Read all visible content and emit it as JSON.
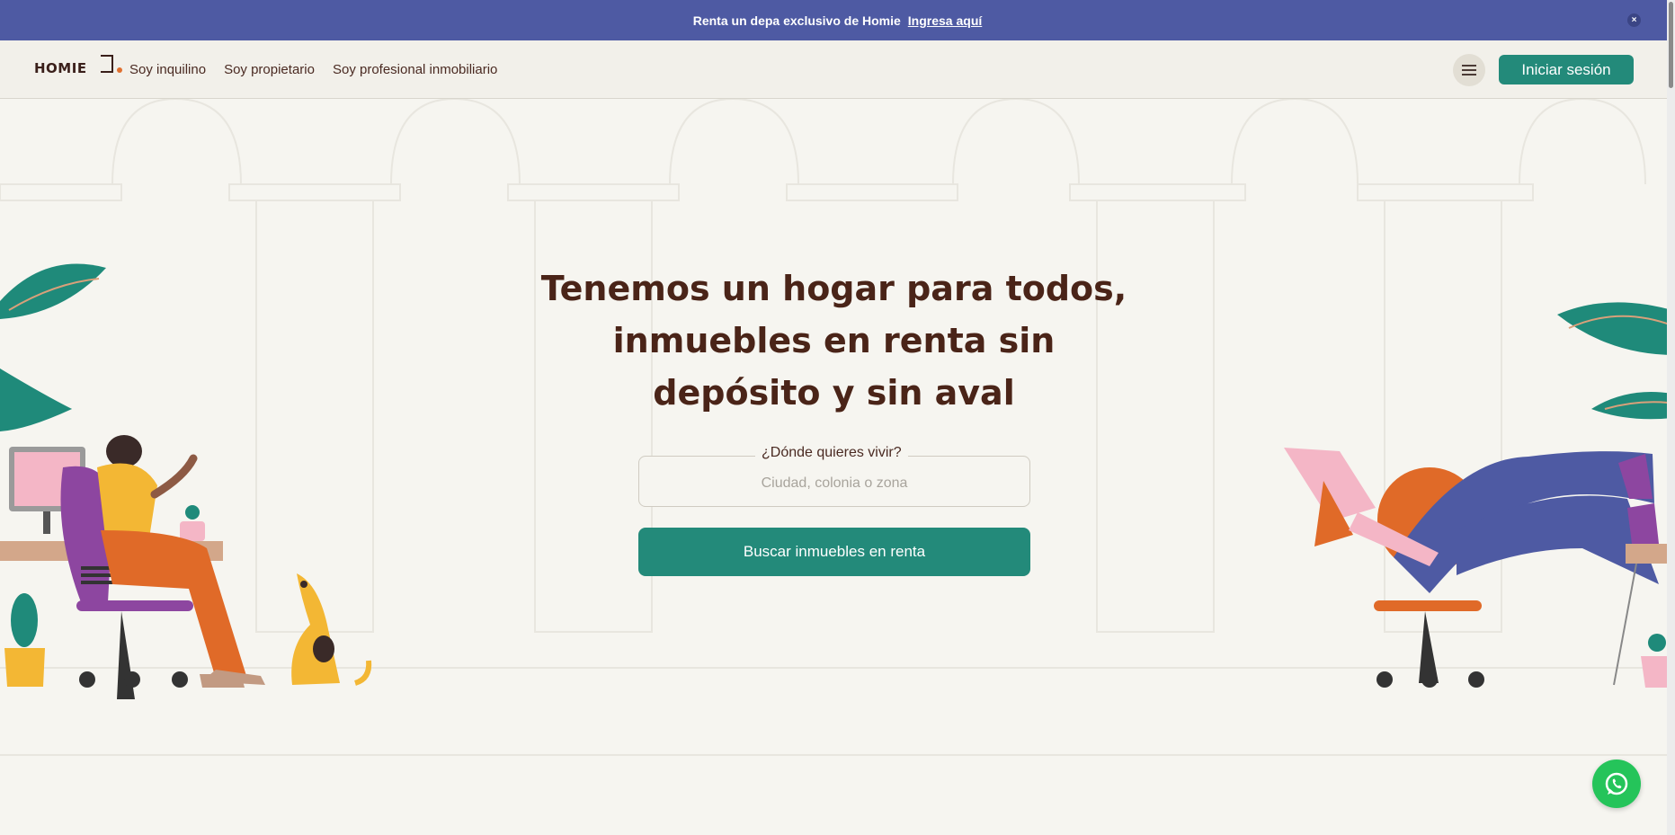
{
  "announcement": {
    "text": "Renta un depa exclusivo de Homie",
    "link": "Ingresa aquí",
    "close": "×"
  },
  "nav": {
    "logo": "HOMIE",
    "links": [
      "Soy inquilino",
      "Soy propietario",
      "Soy profesional inmobiliario"
    ],
    "login": "Iniciar sesión"
  },
  "hero": {
    "title": "Tenemos un hogar para todos, inmuebles en renta sin depósito y sin aval",
    "search_label": "¿Dónde quieres vivir?",
    "search_placeholder": "Ciudad, colonia o zona",
    "search_value": "",
    "button": "Buscar inmuebles en renta"
  },
  "colors": {
    "banner": "#4e5aa3",
    "accent": "#238a7a",
    "text": "#4a2418",
    "whatsapp": "#25c45a"
  },
  "icons": [
    "close-icon",
    "hamburger-menu-icon",
    "whatsapp-icon"
  ]
}
